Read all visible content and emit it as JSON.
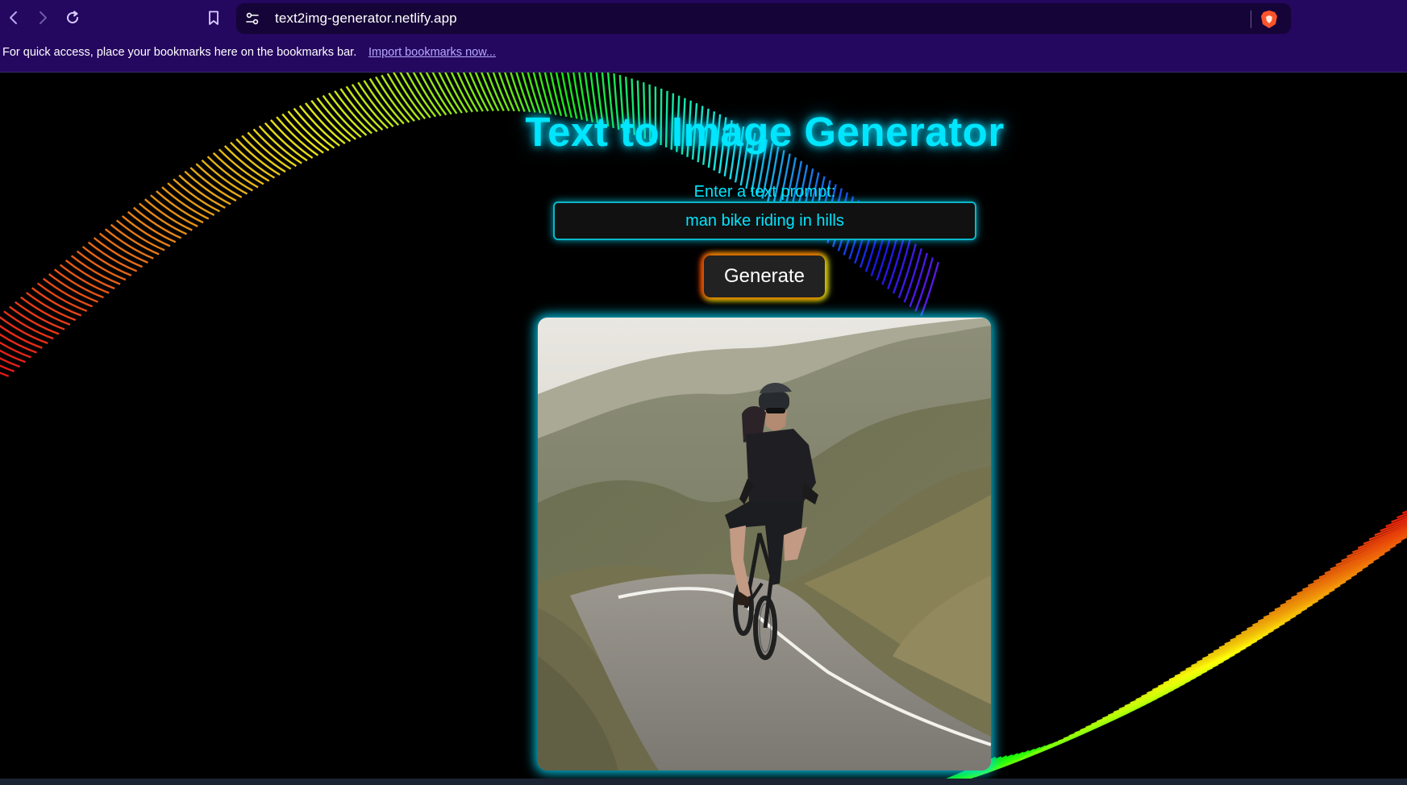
{
  "browser": {
    "url": "text2img-generator.netlify.app",
    "bookmarks_bar": {
      "message": "For quick access, place your bookmarks here on the bookmarks bar.",
      "import_link": "Import bookmarks now..."
    },
    "icons": {
      "back": "back-arrow-icon",
      "forward": "forward-arrow-icon",
      "reload": "reload-icon",
      "bookmark": "bookmark-icon",
      "site_info": "site-settings-icon",
      "brave": "brave-shield-icon"
    }
  },
  "page": {
    "title": "Text to Image Generator",
    "prompt_label": "Enter a text prompt:",
    "prompt_value": "man bike riding in hills",
    "generate_label": "Generate",
    "generated_image": "cyclist riding a bicycle on a road through grassy hills",
    "colors": {
      "accent": "#00e6ff",
      "background": "#000000",
      "chrome": "#24075f"
    }
  }
}
